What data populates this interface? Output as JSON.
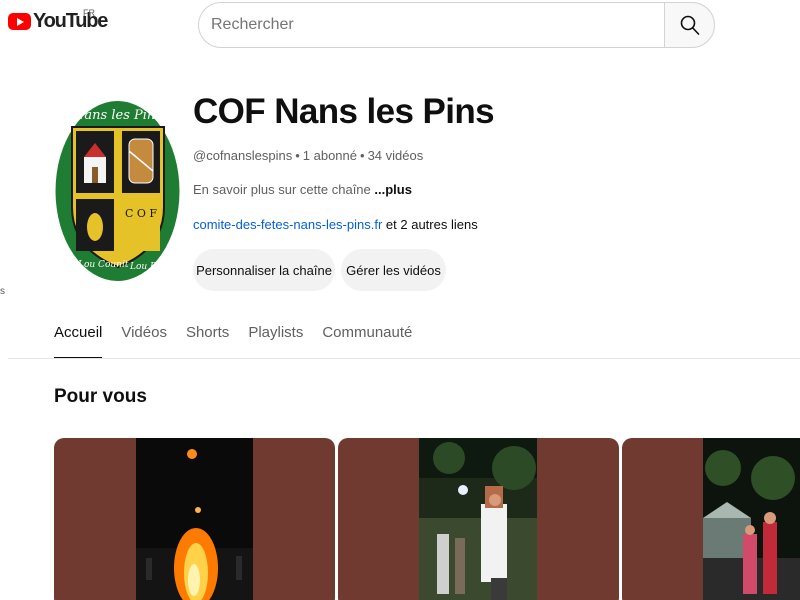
{
  "header": {
    "logo_text": "YouTube",
    "country_code": "FR",
    "search_placeholder": "Rechercher"
  },
  "channel": {
    "name": "COF Nans les Pins",
    "handle": "@cofnanslespins",
    "subscribers": "1 abonné",
    "video_count": "34 vidéos",
    "meta_separator": "•",
    "description": "En savoir plus sur cette chaîne",
    "more_label": "...plus",
    "link": "comite-des-fetes-nans-les-pins.fr",
    "other_links": "et 2 autres liens",
    "avatar_texts": {
      "top": "Nans les Pins",
      "cof_letters": "C O F",
      "motto_left": "Lou Counit",
      "motto_right": "Lou Bon"
    }
  },
  "actions": {
    "customize_label": "Personnaliser la chaîne",
    "manage_label": "Gérer les vidéos"
  },
  "stray_text": "s",
  "tabs": [
    {
      "label": "Accueil",
      "active": true
    },
    {
      "label": "Vidéos",
      "active": false
    },
    {
      "label": "Shorts",
      "active": false
    },
    {
      "label": "Playlists",
      "active": false
    },
    {
      "label": "Communauté",
      "active": false
    }
  ],
  "section": {
    "title": "Pour vous"
  },
  "colors": {
    "brand_red": "#ff0000",
    "link_blue": "#065fd4",
    "thumb_frame": "#703a31",
    "shield_green": "#1e7d32",
    "shield_gold": "#e6c229"
  }
}
